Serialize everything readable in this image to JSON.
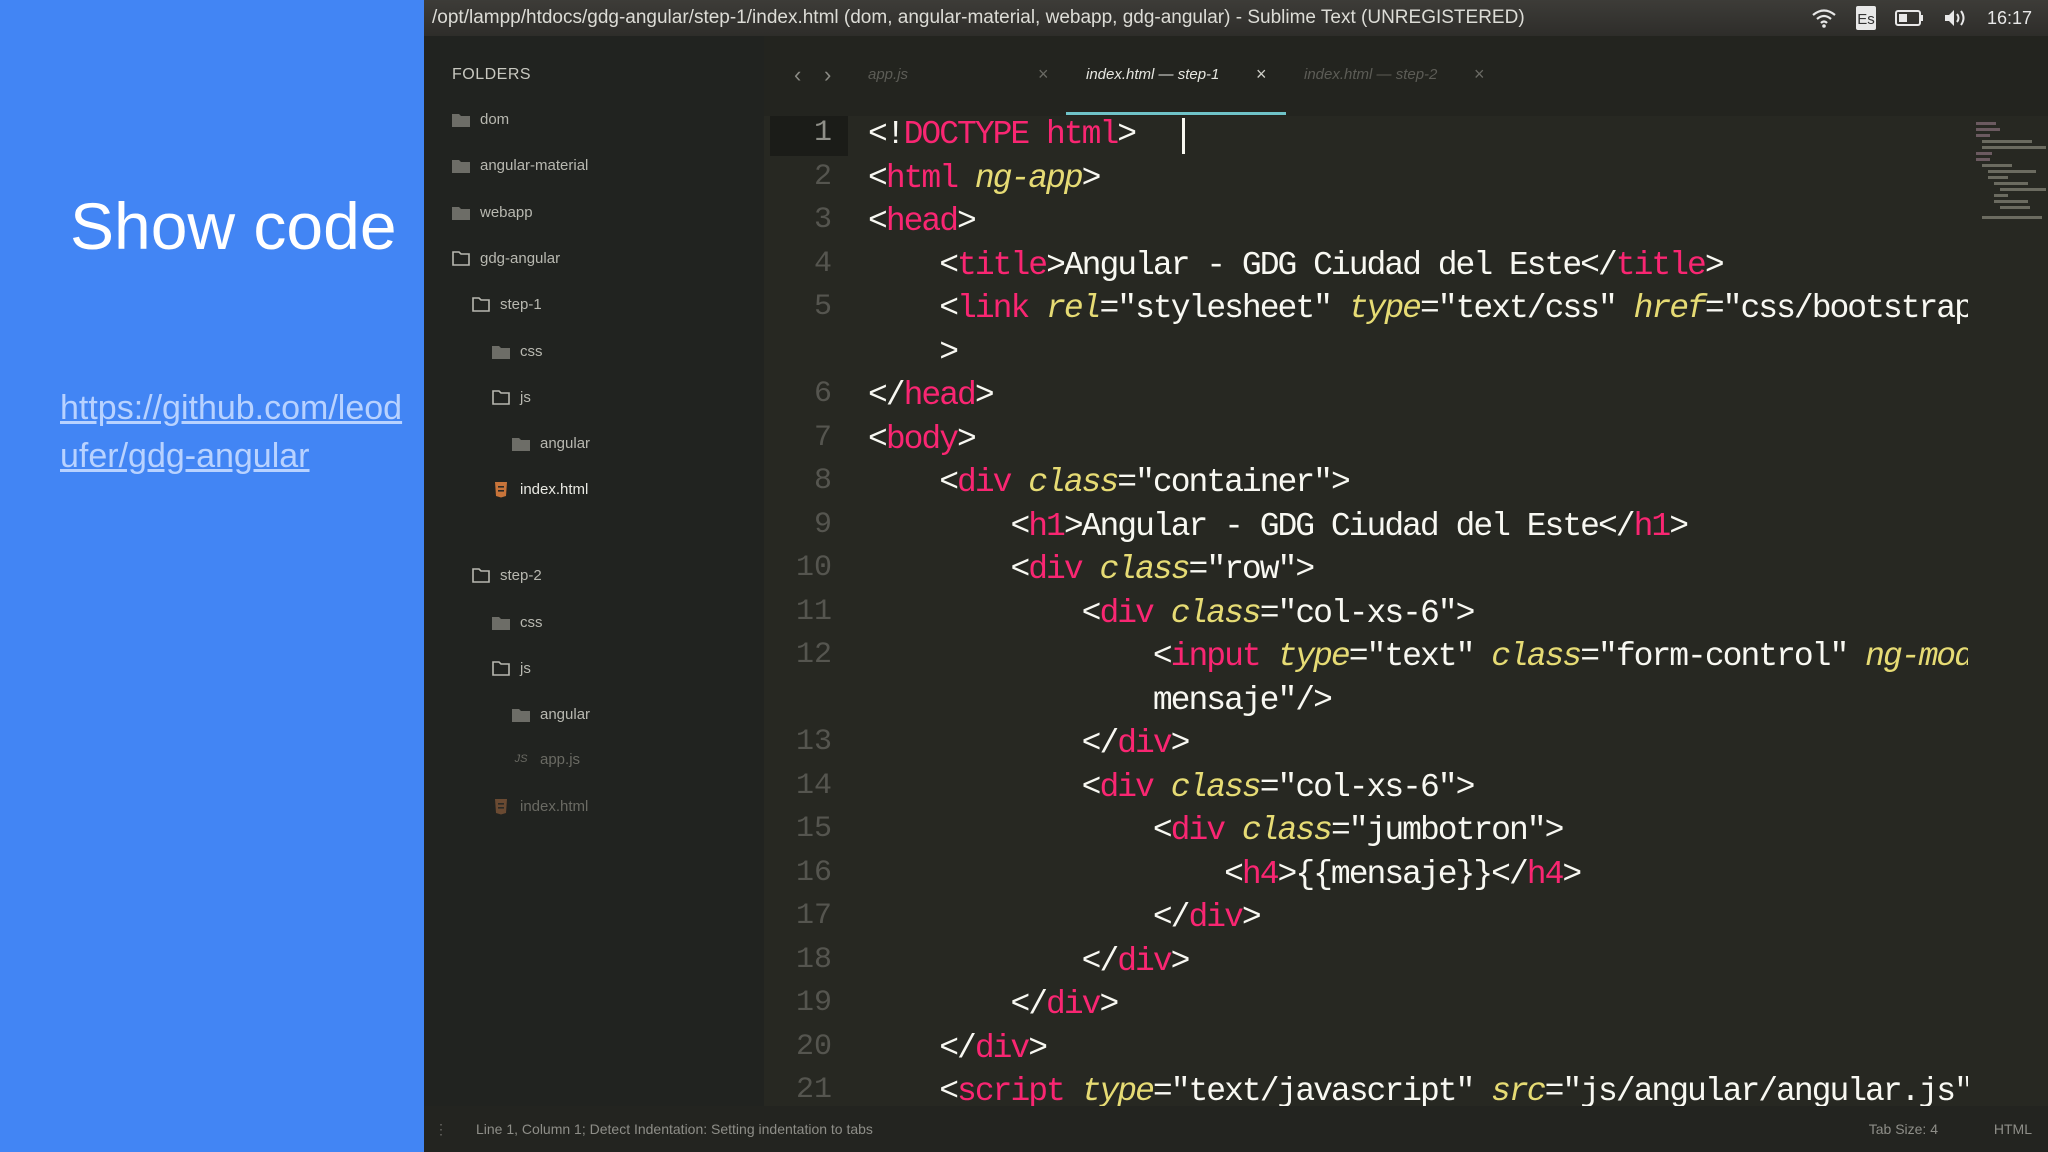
{
  "slide": {
    "title": "Show code",
    "link": "https://github.com/leodufer/gdg-angular",
    "background": "#4285f4"
  },
  "window": {
    "title": "/opt/lampp/htdocs/gdg-angular/step-1/index.html (dom, angular-material, webapp, gdg-angular) - Sublime Text (UNREGISTERED)",
    "clock": "16:17",
    "tray_icons": [
      "wifi-icon",
      "keyboard-icon",
      "battery-icon",
      "volume-icon"
    ]
  },
  "sidebar": {
    "header": "FOLDERS",
    "items": [
      {
        "label": "dom",
        "icon": "folder-closed"
      },
      {
        "label": "angular-material",
        "icon": "folder-closed"
      },
      {
        "label": "webapp",
        "icon": "folder-closed"
      },
      {
        "label": "gdg-angular",
        "icon": "folder-open"
      },
      {
        "label": "step-1",
        "icon": "folder-open"
      },
      {
        "label": "css",
        "icon": "folder-closed"
      },
      {
        "label": "js",
        "icon": "folder-open"
      },
      {
        "label": "angular",
        "icon": "folder-closed"
      },
      {
        "label": "index.html",
        "icon": "html-file",
        "active": true
      },
      {
        "label": "step-2",
        "icon": "folder-open"
      },
      {
        "label": "css",
        "icon": "folder-closed"
      },
      {
        "label": "js",
        "icon": "folder-open"
      },
      {
        "label": "angular",
        "icon": "folder-closed"
      },
      {
        "label": "app.js",
        "icon": "js-file"
      },
      {
        "label": "index.html",
        "icon": "html-file"
      }
    ]
  },
  "tabs": [
    {
      "label": "app.js",
      "active": false
    },
    {
      "label": "index.html — step-1",
      "active": true
    },
    {
      "label": "index.html — step-2",
      "active": false
    }
  ],
  "code": {
    "line_numbers": [
      "1",
      "2",
      "3",
      "4",
      "5",
      "6",
      "7",
      "8",
      "9",
      "10",
      "11",
      "12",
      "13",
      "14",
      "15",
      "16",
      "17",
      "18",
      "19",
      "20",
      "21"
    ],
    "lines": [
      "<!DOCTYPE html>",
      "<html ng-app>",
      "<head>",
      "    <title>Angular - GDG Ciudad del Este</title>",
      "    <link rel=\"stylesheet\" type=\"text/css\" href=\"css/bootstrap.css\"",
      "    >",
      "</head>",
      "<body>",
      "    <div class=\"container\">",
      "        <h1>Angular - GDG Ciudad del Este</h1>",
      "        <div class=\"row\">",
      "            <div class=\"col-xs-6\">",
      "                <input type=\"text\" class=\"form-control\" ng-model=\"",
      "                mensaje\"/>",
      "            </div>",
      "            <div class=\"col-xs-6\">",
      "                <div class=\"jumbotron\">",
      "                    <h4>{{mensaje}}</h4>",
      "                </div>",
      "            </div>",
      "        </div>",
      "    </div>",
      "    <script type=\"text/javascript\" src=\"js/angular/angular.js\"></"
    ]
  },
  "status": {
    "left": "Line 1, Column 1; Detect Indentation: Setting indentation to tabs",
    "tab_size": "Tab Size: 4",
    "syntax": "HTML"
  },
  "colors": {
    "tag": "#f92672",
    "attribute": "#e6db74",
    "text": "#f8f8f2",
    "editor_bg": "#272822"
  }
}
